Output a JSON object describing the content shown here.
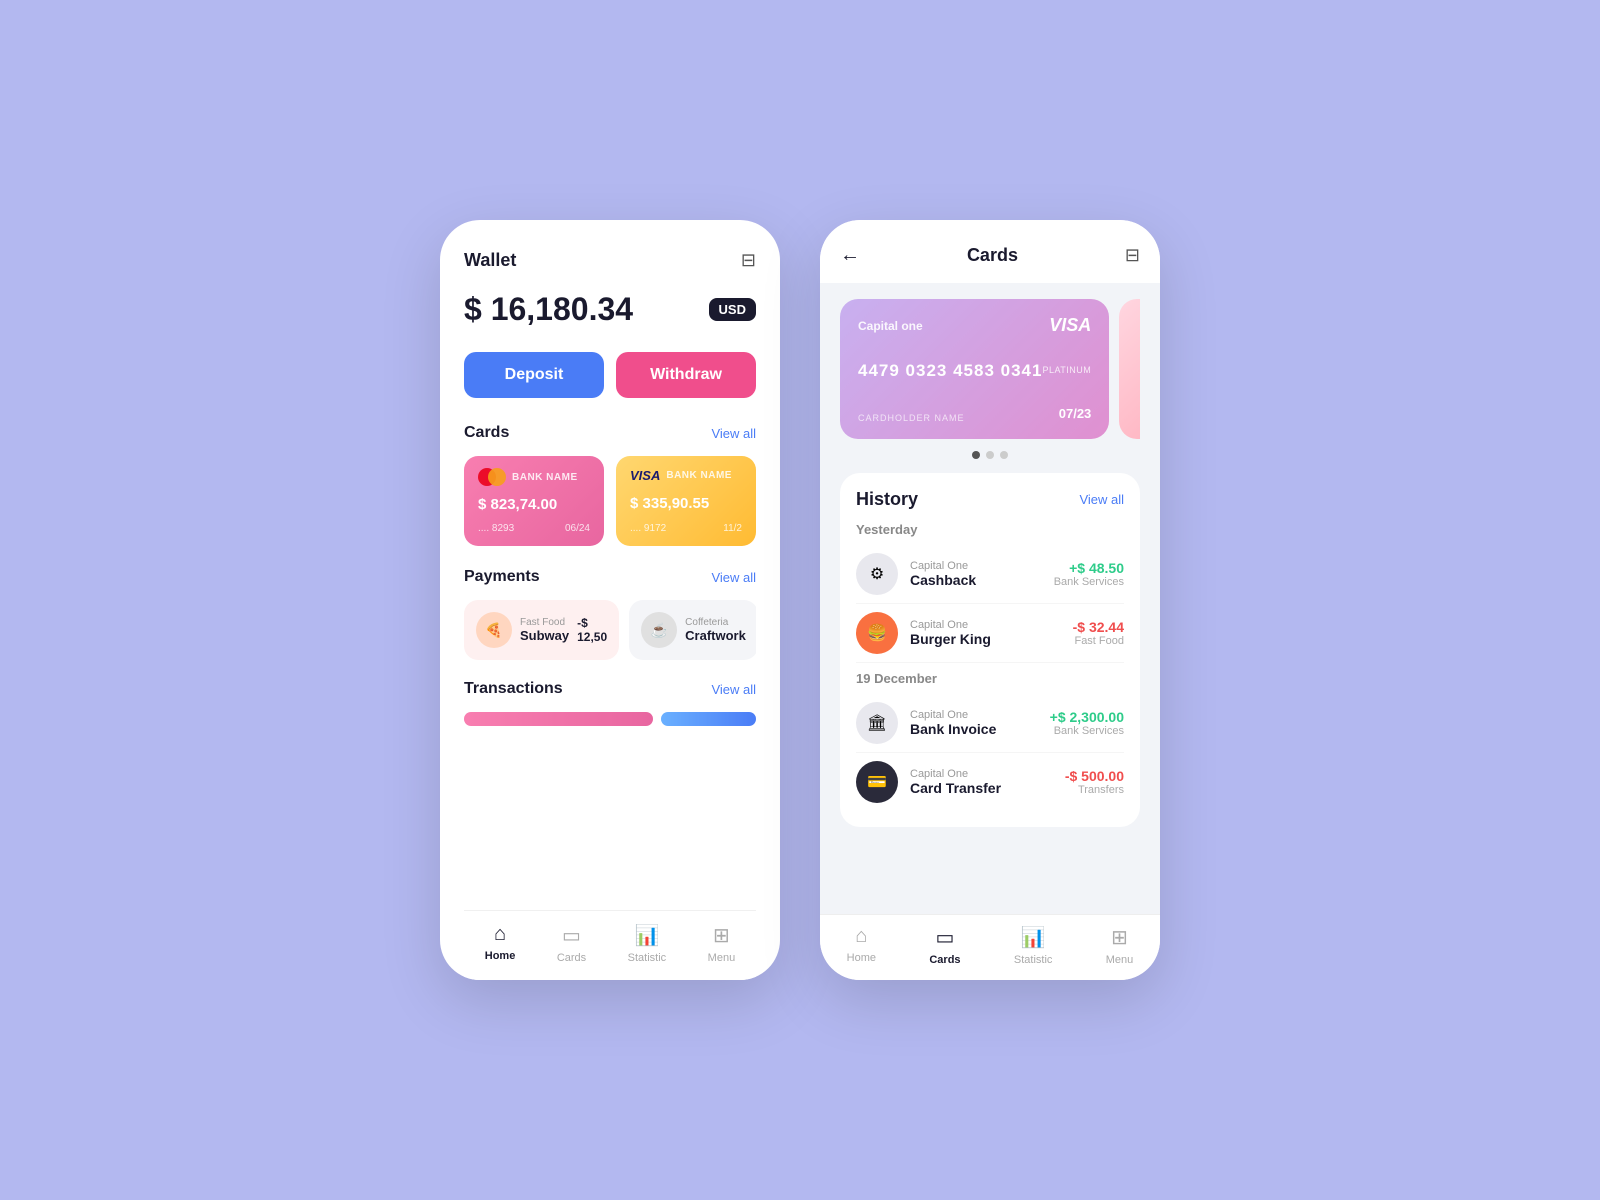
{
  "background_color": "#b3b8f0",
  "left_phone": {
    "header": {
      "title": "Wallet",
      "filter_icon": "⊞"
    },
    "balance": {
      "amount": "$ 16,180.34",
      "currency": "USD"
    },
    "buttons": {
      "deposit": "Deposit",
      "withdraw": "Withdraw"
    },
    "cards_section": {
      "title": "Cards",
      "view_all": "View all",
      "cards": [
        {
          "type": "mastercard",
          "bank": "BANK NAME",
          "amount": "$ 823,74.00",
          "number": ".... 8293",
          "expiry": "06/24"
        },
        {
          "type": "visa",
          "bank": "BANK NAME",
          "amount": "$ 335,90.55",
          "number": ".... 9172",
          "expiry": "11/2"
        }
      ]
    },
    "payments_section": {
      "title": "Payments",
      "view_all": "View all",
      "items": [
        {
          "category": "Fast Food",
          "name": "Subway",
          "amount": "-$ 12,50",
          "icon": "🍕"
        },
        {
          "category": "Coffeteria",
          "name": "Craftwork",
          "amount": "",
          "icon": "☕"
        }
      ]
    },
    "transactions_section": {
      "title": "Transactions",
      "view_all": "View all"
    },
    "bottom_nav": [
      {
        "icon": "⌂",
        "label": "Home",
        "active": true
      },
      {
        "icon": "▭",
        "label": "Cards",
        "active": false
      },
      {
        "icon": "📊",
        "label": "Statistic",
        "active": false
      },
      {
        "icon": "⊞",
        "label": "Menu",
        "active": false
      }
    ]
  },
  "right_phone": {
    "header": {
      "back": "←",
      "title": "Cards",
      "filter_icon": "⊞"
    },
    "featured_card": {
      "issuer": "Capital one",
      "network": "VISA",
      "number": "4479 0323 4583 0341",
      "platinum": "PLATINUM",
      "cardholder_label": "CARDHOLDER NAME",
      "expiry": "07/23"
    },
    "card_dots": [
      {
        "active": true
      },
      {
        "active": false
      },
      {
        "active": false
      }
    ],
    "history": {
      "title": "History",
      "view_all": "View all",
      "groups": [
        {
          "date": "Yesterday",
          "items": [
            {
              "company": "Capital One",
              "name": "Cashback",
              "amount": "+$ 48.50",
              "category": "Bank Services",
              "icon": "⚙",
              "amount_type": "green",
              "icon_bg": "gray"
            },
            {
              "company": "Capital One",
              "name": "Burger King",
              "amount": "-$ 32.44",
              "category": "Fast Food",
              "icon": "🍔",
              "amount_type": "red",
              "icon_bg": "orange"
            }
          ]
        },
        {
          "date": "19 December",
          "items": [
            {
              "company": "Capital One",
              "name": "Bank Invoice",
              "amount": "+$ 2,300.00",
              "category": "Bank Services",
              "icon": "🏛",
              "amount_type": "green",
              "icon_bg": "gray"
            },
            {
              "company": "Capital One",
              "name": "Card Transfer",
              "amount": "-$ 500.00",
              "category": "Transfers",
              "icon": "💳",
              "amount_type": "red",
              "icon_bg": "dark"
            }
          ]
        }
      ]
    },
    "bottom_nav": [
      {
        "icon": "⌂",
        "label": "Home",
        "active": false
      },
      {
        "icon": "▭",
        "label": "Cards",
        "active": true
      },
      {
        "icon": "📊",
        "label": "Statistic",
        "active": false
      },
      {
        "icon": "⊞",
        "label": "Menu",
        "active": false
      }
    ]
  }
}
